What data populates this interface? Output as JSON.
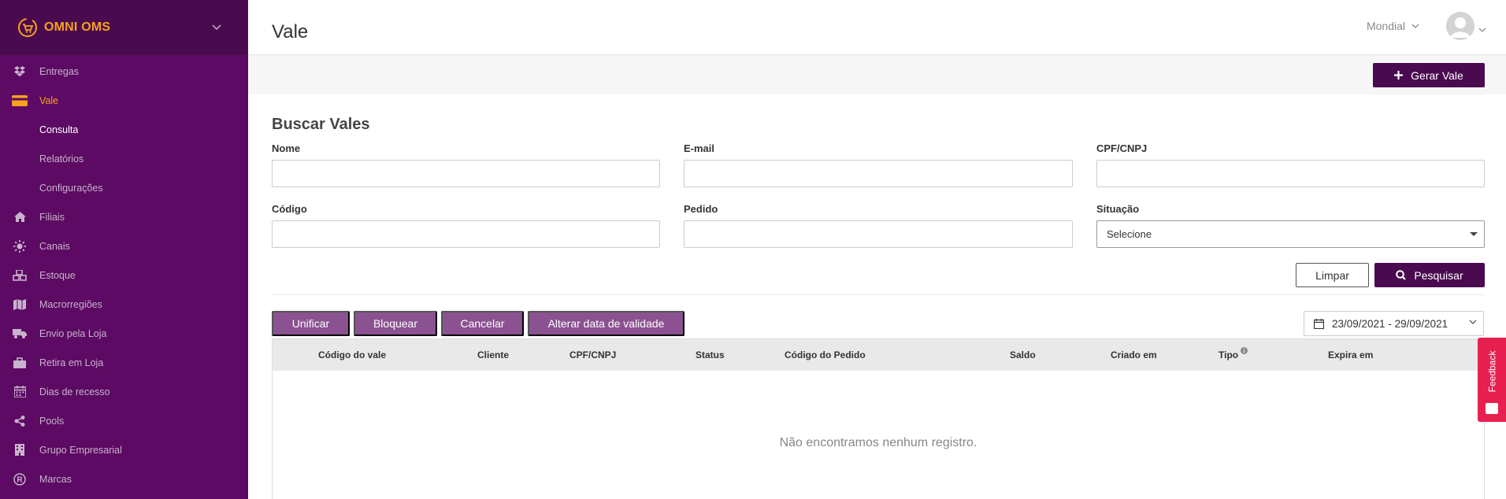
{
  "brand": {
    "name": "OMNI OMS",
    "accent": "#f7a21b",
    "sidebar_bg": "#5c0a63",
    "primary": "#4a0a50",
    "soft_button": "#8b5291"
  },
  "sidebar": {
    "items": [
      {
        "label": "Entregas",
        "icon": "dropbox-icon"
      },
      {
        "label": "Vale",
        "icon": "credit-card-icon",
        "active": true
      },
      {
        "label": "Consulta",
        "sub": true,
        "active": true
      },
      {
        "label": "Relatórios",
        "sub": true
      },
      {
        "label": "Configurações",
        "sub": true
      },
      {
        "label": "Filiais",
        "icon": "home-icon"
      },
      {
        "label": "Canais",
        "icon": "sun-icon"
      },
      {
        "label": "Estoque",
        "icon": "cubes-icon"
      },
      {
        "label": "Macrorregiões",
        "icon": "map-icon"
      },
      {
        "label": "Envio pela Loja",
        "icon": "truck-icon"
      },
      {
        "label": "Retira em Loja",
        "icon": "briefcase-icon"
      },
      {
        "label": "Dias de recesso",
        "icon": "calendar-icon"
      },
      {
        "label": "Pools",
        "icon": "share-icon"
      },
      {
        "label": "Grupo Empresarial",
        "icon": "building-icon"
      },
      {
        "label": "Marcas",
        "icon": "registered-icon"
      }
    ]
  },
  "header": {
    "title": "Vale",
    "store": "Mondial"
  },
  "actions": {
    "gerar_vale": "Gerar Vale"
  },
  "search": {
    "title": "Buscar Vales",
    "nome_label": "Nome",
    "email_label": "E-mail",
    "cpf_label": "CPF/CNPJ",
    "codigo_label": "Código",
    "pedido_label": "Pedido",
    "situacao_label": "Situação",
    "situacao_value": "Selecione",
    "nome_value": "",
    "email_value": "",
    "cpf_value": "",
    "codigo_value": "",
    "pedido_value": "",
    "limpar": "Limpar",
    "pesquisar": "Pesquisar"
  },
  "bulk": {
    "unificar": "Unificar",
    "bloquear": "Bloquear",
    "cancelar": "Cancelar",
    "alterar": "Alterar data de validade"
  },
  "date_range": "23/09/2021 - 29/09/2021",
  "table": {
    "columns": [
      "Código do vale",
      "Cliente",
      "CPF/CNPJ",
      "Status",
      "Código do Pedido",
      "Saldo",
      "Criado em",
      "Tipo",
      "Expira em"
    ],
    "empty": "Não encontramos nenhum registro."
  },
  "feedback": "Feedback"
}
